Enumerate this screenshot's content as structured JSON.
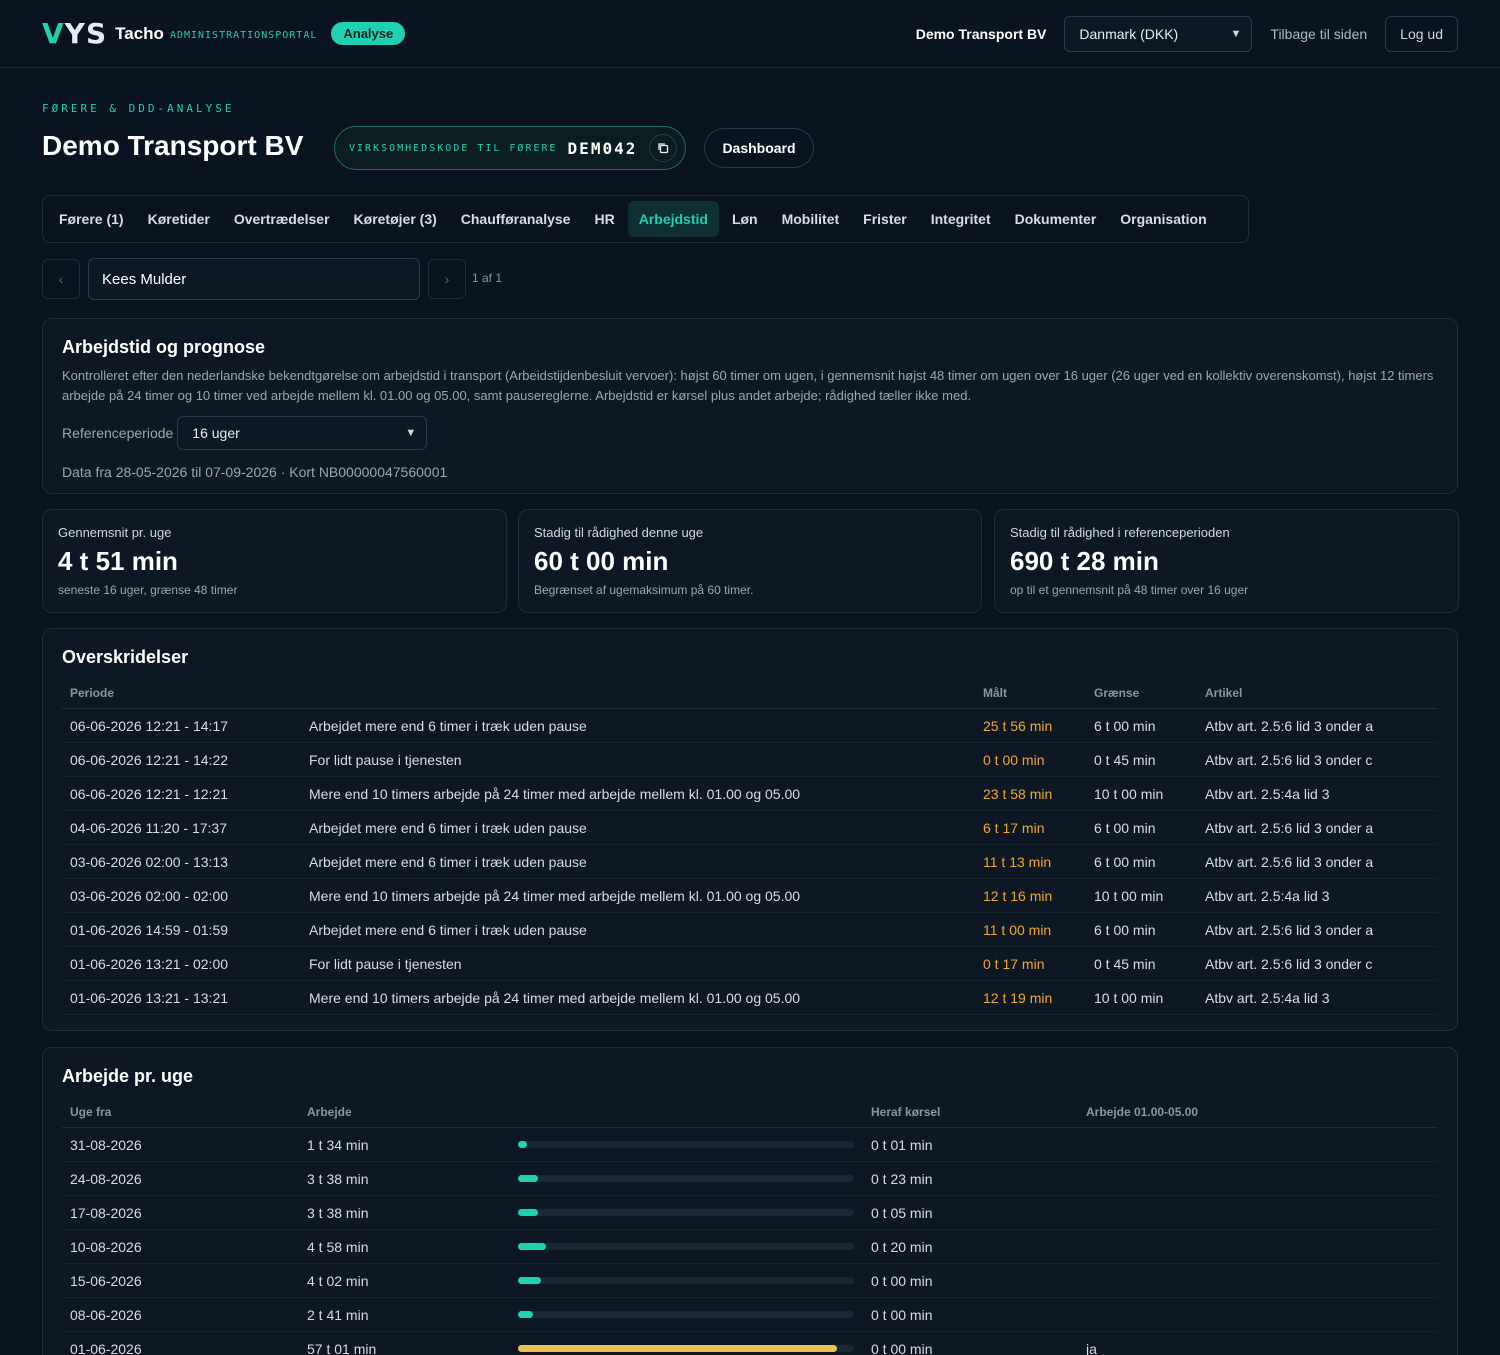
{
  "header": {
    "logo_mark_1": "V",
    "logo_mark_2": "YS",
    "app_name": "Tacho",
    "app_sub": "ADMINISTRATIONSPORTAL",
    "badge": "Analyse",
    "company": "Demo Transport BV",
    "country_select": "Danmark (DKK)",
    "back_link": "Tilbage til siden",
    "logout": "Log ud"
  },
  "page": {
    "kicker": "FØRERE & DDD-ANALYSE",
    "title": "Demo Transport BV",
    "code_label": "VIRKSOMHEDSKODE TIL FØRERE",
    "code_value": "DEM042",
    "dashboard_button": "Dashboard"
  },
  "tabs": [
    {
      "label": "Førere (1)",
      "active": false
    },
    {
      "label": "Køretider",
      "active": false
    },
    {
      "label": "Overtrædelser",
      "active": false
    },
    {
      "label": "Køretøjer (3)",
      "active": false
    },
    {
      "label": "Chaufføranalyse",
      "active": false
    },
    {
      "label": "HR",
      "active": false
    },
    {
      "label": "Arbejdstid",
      "active": true
    },
    {
      "label": "Løn",
      "active": false
    },
    {
      "label": "Mobilitet",
      "active": false
    },
    {
      "label": "Frister",
      "active": false
    },
    {
      "label": "Integritet",
      "active": false
    },
    {
      "label": "Dokumenter",
      "active": false
    },
    {
      "label": "Organisation",
      "active": false
    }
  ],
  "pager": {
    "prev": "‹",
    "next": "›",
    "driver": "Kees Mulder",
    "text": "1 af 1"
  },
  "worktime": {
    "title": "Arbejdstid og prognose",
    "description": "Kontrolleret efter den nederlandske bekendtgørelse om arbejdstid i transport (Arbeidstijdenbesluit vervoer): højst 60 timer om ugen, i gennemsnit højst 48 timer om ugen over 16 uger (26 uger ved en kollektiv overenskomst), højst 12 timers arbejde på 24 timer og 10 timer ved arbejde mellem kl. 01.00 og 05.00, samt pausereglerne. Arbejdstid er kørsel plus andet arbejde; rådighed tæller ikke med.",
    "ref_label": "Referenceperiode",
    "ref_value": "16 uger",
    "meta": "Data fra 28-05-2026 til 07-09-2026 · Kort NB00000047560001"
  },
  "stats": [
    {
      "label": "Gennemsnit pr. uge",
      "value": "4 t 51 min",
      "sub": "seneste 16 uger, grænse 48 timer"
    },
    {
      "label": "Stadig til rådighed denne uge",
      "value": "60 t 00 min",
      "sub": "Begrænset af ugemaksimum på 60 timer."
    },
    {
      "label": "Stadig til rådighed i referenceperioden",
      "value": "690 t 28 min",
      "sub": "op til et gennemsnit på 48 timer over 16 uger"
    }
  ],
  "violations": {
    "title": "Overskridelser",
    "headers": {
      "period": "Periode",
      "desc": "",
      "measured": "Målt",
      "limit": "Grænse",
      "article": "Artikel"
    },
    "rows": [
      {
        "period": "06-06-2026 12:21 - 14:17",
        "desc": "Arbejdet mere end 6 timer i træk uden pause",
        "measured": "25 t 56 min",
        "limit": "6 t 00 min",
        "article": "Atbv art. 2.5:6 lid 3 onder a"
      },
      {
        "period": "06-06-2026 12:21 - 14:22",
        "desc": "For lidt pause i tjenesten",
        "measured": "0 t 00 min",
        "limit": "0 t 45 min",
        "article": "Atbv art. 2.5:6 lid 3 onder c"
      },
      {
        "period": "06-06-2026 12:21 - 12:21",
        "desc": "Mere end 10 timers arbejde på 24 timer med arbejde mellem kl. 01.00 og 05.00",
        "measured": "23 t 58 min",
        "limit": "10 t 00 min",
        "article": "Atbv art. 2.5:4a lid 3"
      },
      {
        "period": "04-06-2026 11:20 - 17:37",
        "desc": "Arbejdet mere end 6 timer i træk uden pause",
        "measured": "6 t 17 min",
        "limit": "6 t 00 min",
        "article": "Atbv art. 2.5:6 lid 3 onder a"
      },
      {
        "period": "03-06-2026 02:00 - 13:13",
        "desc": "Arbejdet mere end 6 timer i træk uden pause",
        "measured": "11 t 13 min",
        "limit": "6 t 00 min",
        "article": "Atbv art. 2.5:6 lid 3 onder a"
      },
      {
        "period": "03-06-2026 02:00 - 02:00",
        "desc": "Mere end 10 timers arbejde på 24 timer med arbejde mellem kl. 01.00 og 05.00",
        "measured": "12 t 16 min",
        "limit": "10 t 00 min",
        "article": "Atbv art. 2.5:4a lid 3"
      },
      {
        "period": "01-06-2026 14:59 - 01:59",
        "desc": "Arbejdet mere end 6 timer i træk uden pause",
        "measured": "11 t 00 min",
        "limit": "6 t 00 min",
        "article": "Atbv art. 2.5:6 lid 3 onder a"
      },
      {
        "period": "01-06-2026 13:21 - 02:00",
        "desc": "For lidt pause i tjenesten",
        "measured": "0 t 17 min",
        "limit": "0 t 45 min",
        "article": "Atbv art. 2.5:6 lid 3 onder c"
      },
      {
        "period": "01-06-2026 13:21 - 13:21",
        "desc": "Mere end 10 timers arbejde på 24 timer med arbejde mellem kl. 01.00 og 05.00",
        "measured": "12 t 19 min",
        "limit": "10 t 00 min",
        "article": "Atbv art. 2.5:4a lid 3"
      }
    ]
  },
  "weeks": {
    "title": "Arbejde pr. uge",
    "headers": {
      "week": "Uge fra",
      "work": "Arbejde",
      "bar": "",
      "driving": "Heraf kørsel",
      "night": "Arbejde 01.00-05.00"
    },
    "accent": "#1fd1b0",
    "over_color": "#e8c54a",
    "rows": [
      {
        "week": "31-08-2026",
        "work": "1 t 34 min",
        "fill": 0.026,
        "over": false,
        "driving": "0 t 01 min",
        "night": ""
      },
      {
        "week": "24-08-2026",
        "work": "3 t 38 min",
        "fill": 0.061,
        "over": false,
        "driving": "0 t 23 min",
        "night": ""
      },
      {
        "week": "17-08-2026",
        "work": "3 t 38 min",
        "fill": 0.061,
        "over": false,
        "driving": "0 t 05 min",
        "night": ""
      },
      {
        "week": "10-08-2026",
        "work": "4 t 58 min",
        "fill": 0.083,
        "over": false,
        "driving": "0 t 20 min",
        "night": ""
      },
      {
        "week": "15-06-2026",
        "work": "4 t 02 min",
        "fill": 0.067,
        "over": false,
        "driving": "0 t 00 min",
        "night": ""
      },
      {
        "week": "08-06-2026",
        "work": "2 t 41 min",
        "fill": 0.045,
        "over": false,
        "driving": "0 t 00 min",
        "night": ""
      },
      {
        "week": "01-06-2026",
        "work": "57 t 01 min",
        "fill": 0.95,
        "over": true,
        "driving": "0 t 00 min",
        "night": "ja"
      }
    ]
  }
}
